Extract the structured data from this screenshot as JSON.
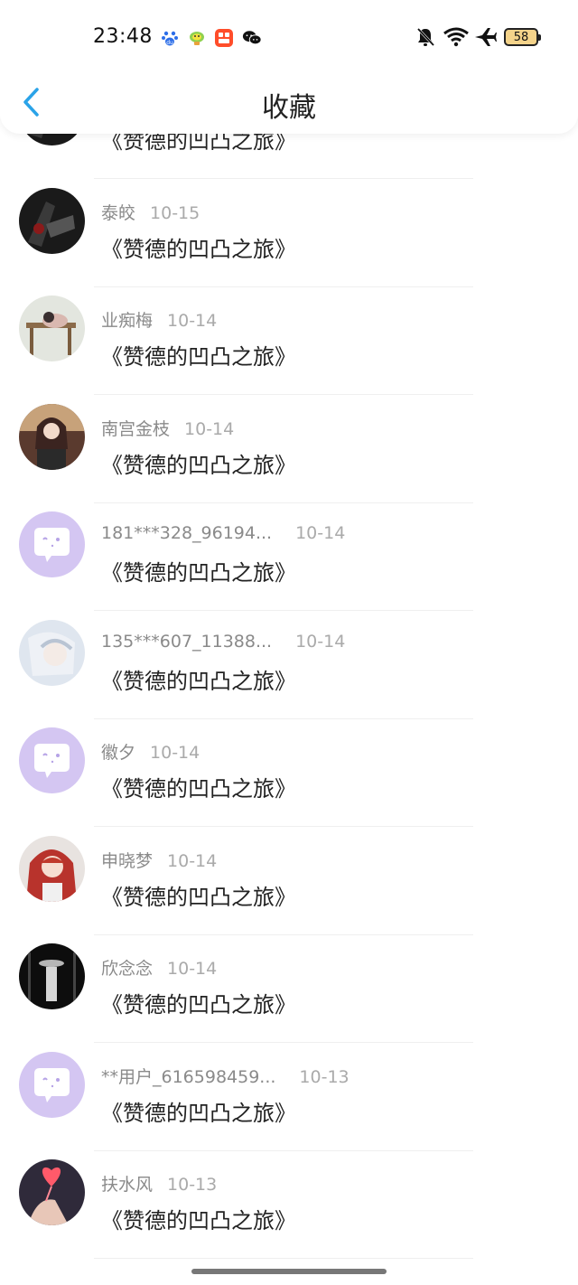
{
  "status_bar": {
    "time": "23:48",
    "battery": "58",
    "app_icons": [
      "baidu-icon",
      "qq-icon",
      "kuaishou-icon",
      "wechat-icon"
    ],
    "right_icons": [
      "mute-icon",
      "wifi-icon",
      "airplane-icon",
      "battery-icon"
    ]
  },
  "header": {
    "title": "收藏",
    "back_icon": "back-arrow-icon"
  },
  "colors": {
    "accent": "#2aa3e8",
    "default_avatar": "#d4c6f2",
    "muted_text": "#8a8a8a"
  },
  "items": [
    {
      "user": "",
      "date": "",
      "title": "《赞德的凹凸之旅》",
      "avatar": "dark-photo"
    },
    {
      "user": "泰皎",
      "date": "10-15",
      "title": "《赞德的凹凸之旅》",
      "avatar": "dark-photo"
    },
    {
      "user": "业痴梅",
      "date": "10-14",
      "title": "《赞德的凹凸之旅》",
      "avatar": "light-photo"
    },
    {
      "user": "南宫金枝",
      "date": "10-14",
      "title": "《赞德的凹凸之旅》",
      "avatar": "portrait-photo"
    },
    {
      "user": "181***328_96194...",
      "date": "10-14",
      "title": "《赞德的凹凸之旅》",
      "avatar": "default"
    },
    {
      "user": "135***607_11388...",
      "date": "10-14",
      "title": "《赞德的凹凸之旅》",
      "avatar": "pale-photo"
    },
    {
      "user": "徽夕",
      "date": "10-14",
      "title": "《赞德的凹凸之旅》",
      "avatar": "default"
    },
    {
      "user": "申晓梦",
      "date": "10-14",
      "title": "《赞德的凹凸之旅》",
      "avatar": "red-hair-photo"
    },
    {
      "user": "欣念念",
      "date": "10-14",
      "title": "《赞德的凹凸之旅》",
      "avatar": "black-photo"
    },
    {
      "user": "**用户_616598459...",
      "date": "10-13",
      "title": "《赞德的凹凸之旅》",
      "avatar": "default"
    },
    {
      "user": "扶水风",
      "date": "10-13",
      "title": "《赞德的凹凸之旅》",
      "avatar": "hand-photo"
    }
  ]
}
